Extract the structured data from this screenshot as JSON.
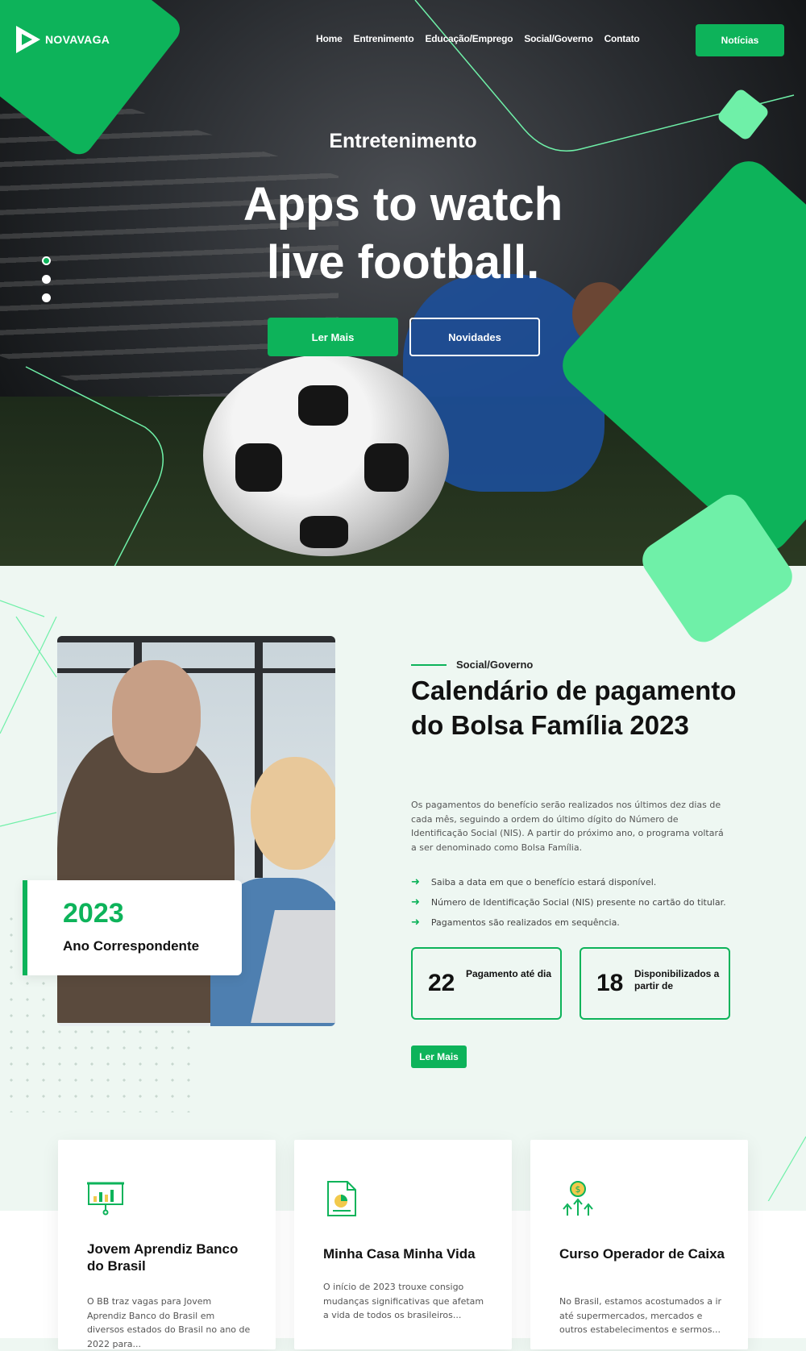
{
  "brand": {
    "name": "NOVAVAGA"
  },
  "nav": {
    "items": [
      "Home",
      "Entrenimento",
      "Educação/Emprego",
      "Social/Governo",
      "Contato"
    ],
    "cta": "Notícias"
  },
  "hero": {
    "kicker": "Entretenimento",
    "title": "Apps to watch live football.",
    "button_primary": "Ler Mais",
    "button_secondary": "Novidades",
    "slides": 3,
    "active_slide": 1
  },
  "feature": {
    "year": "2023",
    "year_label": "Ano Correspondente",
    "category": "Social/Governo",
    "title": "Calendário de pagamento do Bolsa Família 2023",
    "paragraph": "Os pagamentos do benefício serão realizados nos últimos dez dias de cada mês, seguindo a ordem do último dígito do Número de Identificação Social (NIS). A partir do próximo ano, o programa voltará a ser denominado como Bolsa Família.",
    "checks": [
      "Saiba a data em que o benefício estará disponível.",
      "Número de Identificação Social (NIS) presente no cartão do titular.",
      "Pagamentos são realizados em sequência."
    ],
    "stats": [
      {
        "number": "22",
        "label": "Pagamento até dia"
      },
      {
        "number": "18",
        "label": "Disponibilizados a partir de"
      }
    ],
    "button": "Ler Mais"
  },
  "cards": [
    {
      "icon": "presentation-chart-icon",
      "title": "Jovem Aprendiz Banco do Brasil",
      "text": "O BB traz vagas para Jovem Aprendiz Banco do Brasil em diversos estados do Brasil no ano de 2022 para..."
    },
    {
      "icon": "document-chart-icon",
      "title": "Minha Casa Minha Vida",
      "text": "O início de 2023 trouxe consigo mudanças significativas que afetam a vida de todos os brasileiros..."
    },
    {
      "icon": "money-growth-icon",
      "title": "Curso Operador de Caixa",
      "text": "No Brasil, estamos acostumados a ir até supermercados, mercados e outros estabelecimentos e sermos..."
    }
  ],
  "colors": {
    "accent": "#0db35a",
    "accent_light": "#6ff0a8",
    "section_bg": "#eef7f2"
  }
}
